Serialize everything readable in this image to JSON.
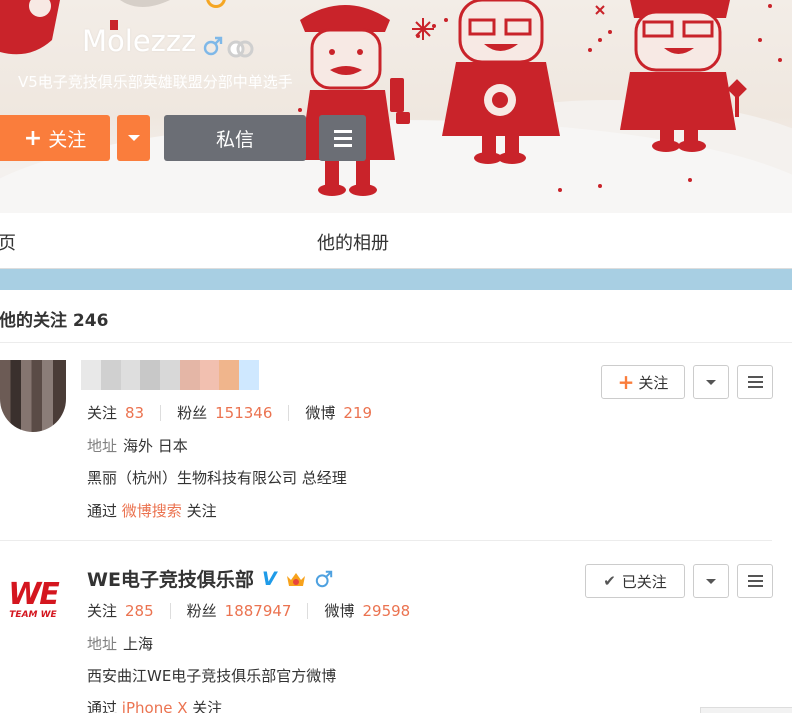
{
  "profile": {
    "screen_name": "Molezzz",
    "bio": "V5电子竞技俱乐部英雄联盟分部中单选手",
    "follow_label": "关注",
    "message_label": "私信"
  },
  "nav": {
    "home_partial": "页",
    "album": "他的相册"
  },
  "follow_section": {
    "title": "他的关注 246"
  },
  "follows": [
    {
      "name": "",
      "follow_count": "83",
      "fans_count": "151346",
      "weibo_count": "219",
      "location": "海外 日本",
      "description": "黑丽（杭州）生物科技有限公司 总经理",
      "via_prefix": "通过",
      "via_source": "微博搜索",
      "via_suffix": "关注",
      "action_label": "关注",
      "action_state": "not_following"
    },
    {
      "name": "WE电子竞技俱乐部",
      "follow_count": "285",
      "fans_count": "1887947",
      "weibo_count": "29598",
      "location": "上海",
      "description": "西安曲江WE电子竞技俱乐部官方微博",
      "via_prefix": "通过",
      "via_source": "iPhone X",
      "via_suffix": "关注",
      "action_label": "已关注",
      "action_state": "following",
      "logo_text": "WE",
      "logo_subtext": "TEAM WE",
      "verified_mark": "V"
    }
  ],
  "labels": {
    "follow": "关注",
    "fans": "粉丝",
    "weibo": "微博",
    "address": "地址"
  },
  "colors": {
    "accent_orange": "#fa7d3c",
    "number_orange": "#eb7350",
    "dark_button": "#6b6e75",
    "blue_bar": "#a8cfe3",
    "we_red": "#d4161f",
    "verify_blue": "#1f9be8"
  },
  "icons": {
    "follow_plus": "plus-icon",
    "dropdown": "caret-down-icon",
    "menu": "hamburger-icon",
    "gender": "male-icon",
    "following_check": "check-icon"
  }
}
